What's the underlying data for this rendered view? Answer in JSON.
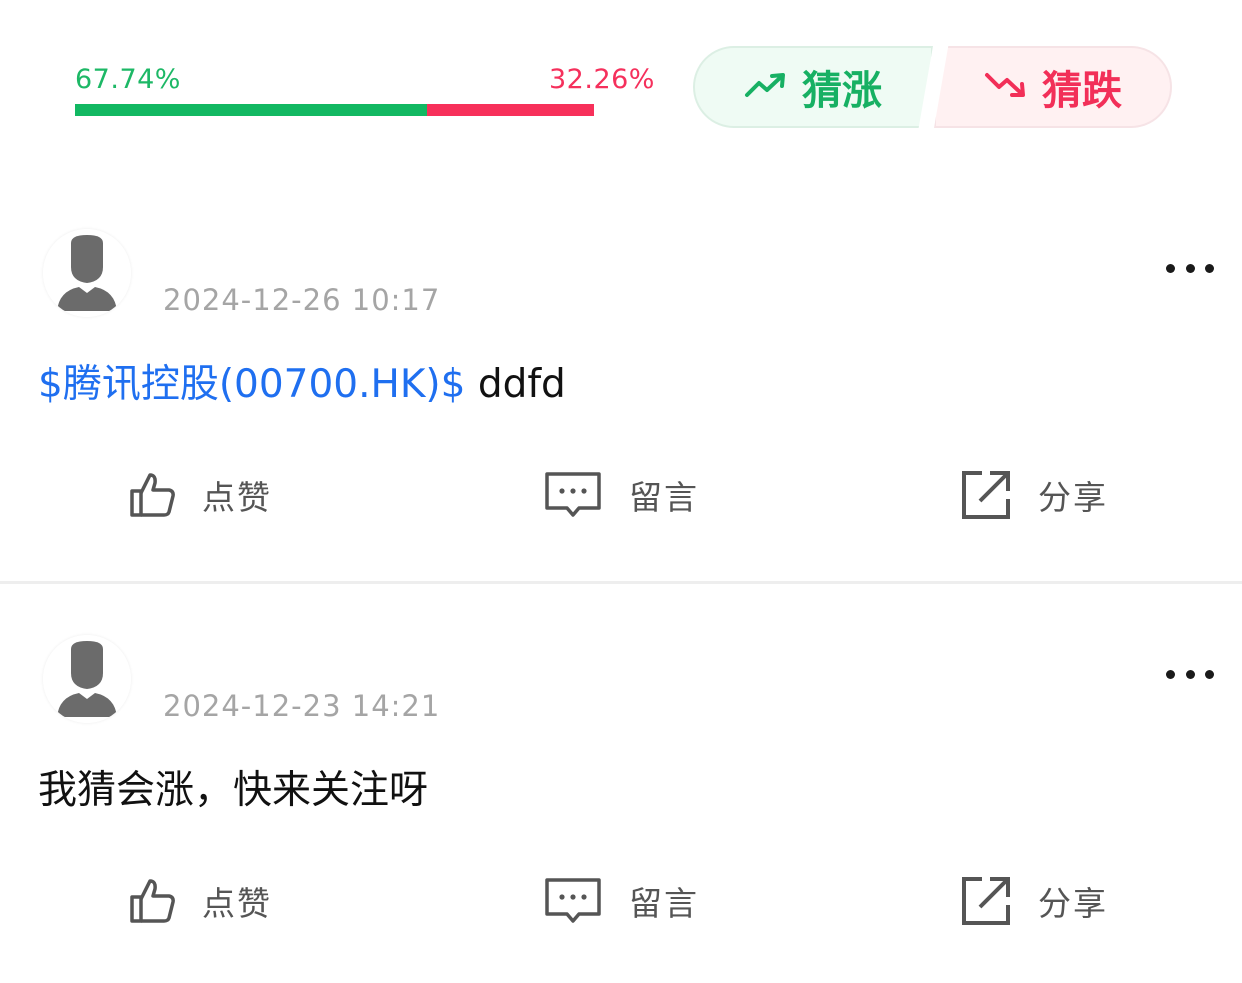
{
  "sentiment": {
    "up_percent_label": "67.74%",
    "down_percent_label": "32.26%",
    "up_fraction": 0.6774,
    "down_fraction": 0.3226,
    "up_color": "#12b862",
    "down_color": "#f7305a"
  },
  "guess": {
    "up_label": "猜涨",
    "down_label": "猜跌",
    "up_icon": "trend-up-icon",
    "down_icon": "trend-down-icon"
  },
  "posts": [
    {
      "time": "2024-12-26 10:17",
      "stock_tag": "$腾讯控股(00700.HK)$",
      "text": " ddfd",
      "actions": {
        "like": "点赞",
        "comment": "留言",
        "share": "分享"
      }
    },
    {
      "time": "2024-12-23 14:21",
      "stock_tag": "",
      "text": "我猜会涨，快来关注呀",
      "actions": {
        "like": "点赞",
        "comment": "留言",
        "share": "分享"
      }
    }
  ],
  "colors": {
    "link": "#1f6ff0",
    "timestamp": "#a5a5a5"
  }
}
